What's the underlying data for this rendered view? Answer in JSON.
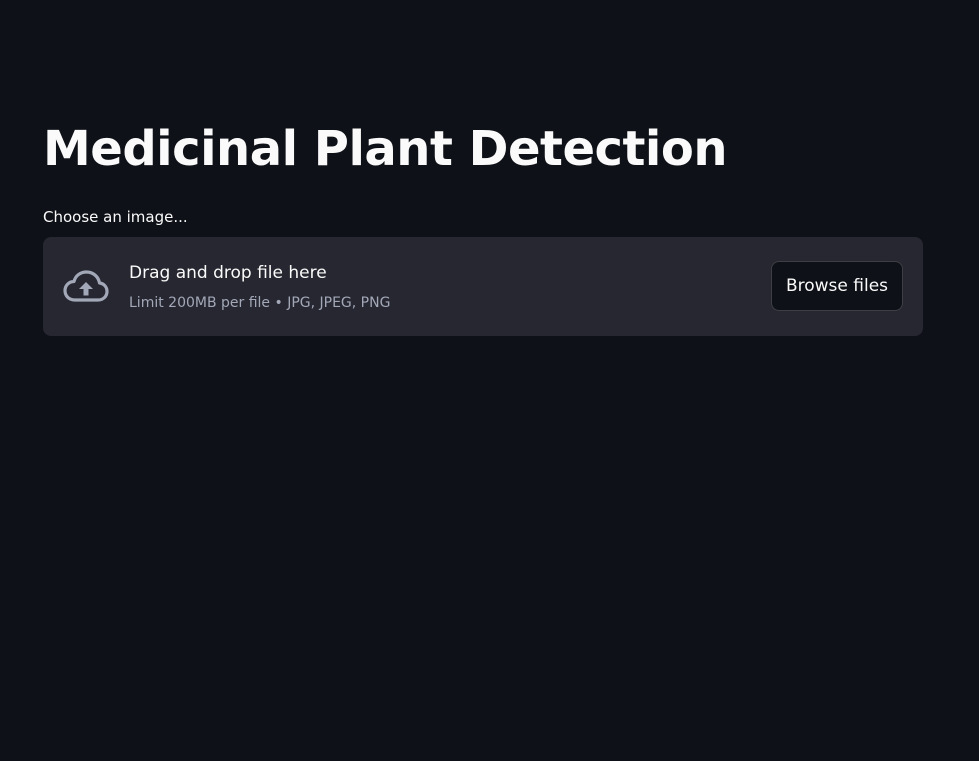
{
  "page": {
    "title": "Medicinal Plant Detection",
    "background_color": "#0e1117"
  },
  "uploader": {
    "label": "Choose an image...",
    "drop_text": "Drag and drop file here",
    "limit_text": "Limit 200MB per file • JPG, JPEG, PNG",
    "browse_label": "Browse files",
    "icon": "cloud-upload-icon",
    "dropzone_color": "#262730"
  }
}
